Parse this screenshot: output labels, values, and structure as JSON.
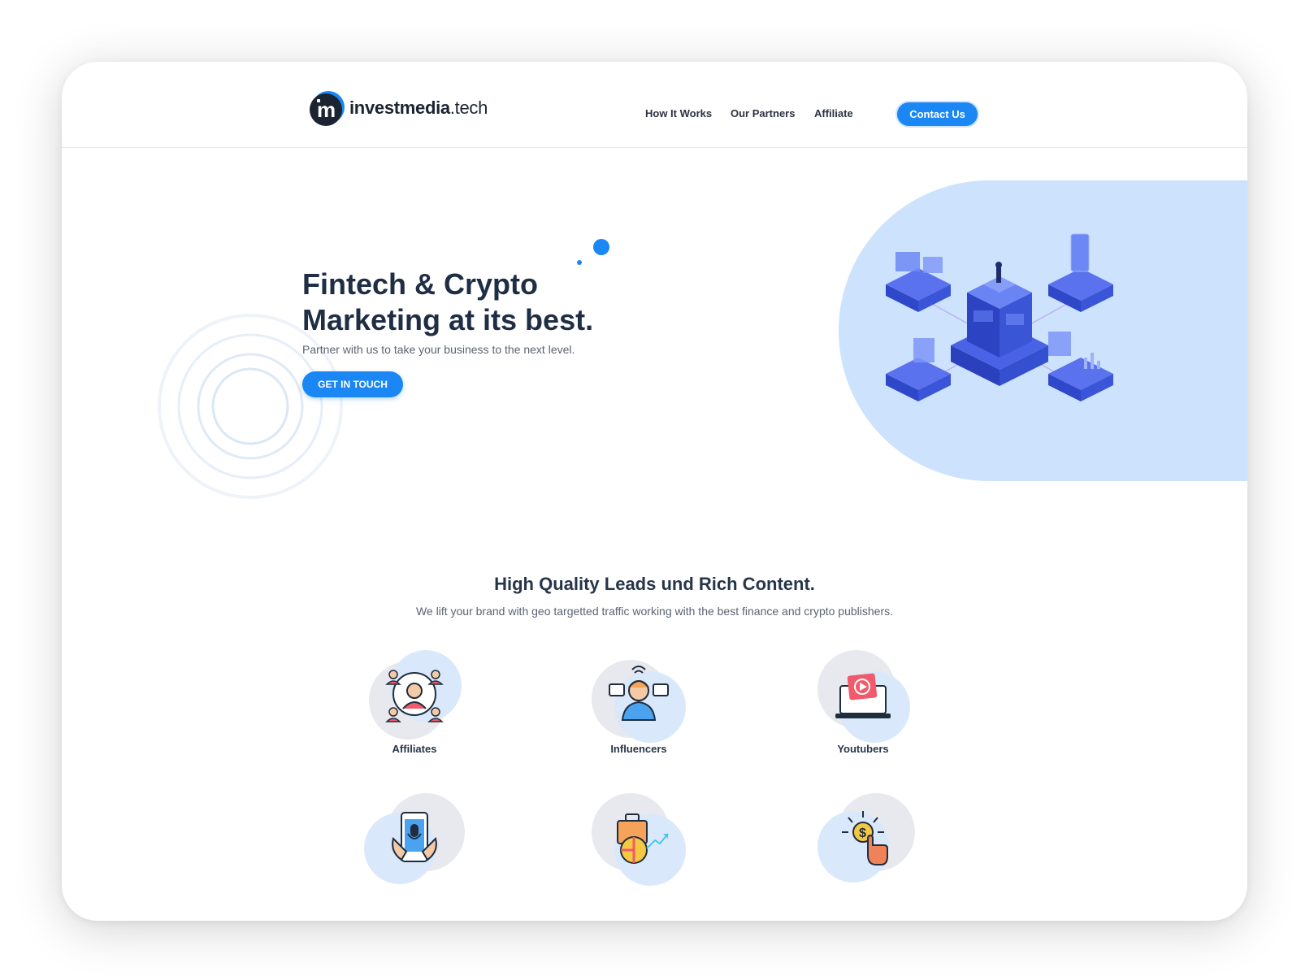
{
  "brand": {
    "name_bold": "investmedia",
    "name_light": ".tech",
    "accent": "#1a87f5"
  },
  "nav": {
    "items": [
      {
        "label": "How It Works"
      },
      {
        "label": "Our Partners"
      },
      {
        "label": "Affiliate"
      }
    ],
    "contact_label": "Contact Us"
  },
  "hero": {
    "title_line1": "Fintech & Crypto",
    "title_line2": "Marketing at its best.",
    "subtitle": "Partner with us to take your business to the next level.",
    "cta_label": "GET IN TOUCH",
    "illustration_icon": "isometric-server-network-icon"
  },
  "section": {
    "title": "High Quality Leads und Rich Content.",
    "subtitle": "We lift your brand with geo targetted traffic working with the best finance and crypto publishers."
  },
  "categories": [
    {
      "label": "Affiliates",
      "icon": "affiliate-network-icon"
    },
    {
      "label": "Influencers",
      "icon": "influencer-icon"
    },
    {
      "label": "Youtubers",
      "icon": "video-laptop-icon"
    },
    {
      "label": "",
      "icon": "podcast-phone-icon"
    },
    {
      "label": "",
      "icon": "business-growth-icon"
    },
    {
      "label": "",
      "icon": "click-dollar-icon"
    }
  ]
}
